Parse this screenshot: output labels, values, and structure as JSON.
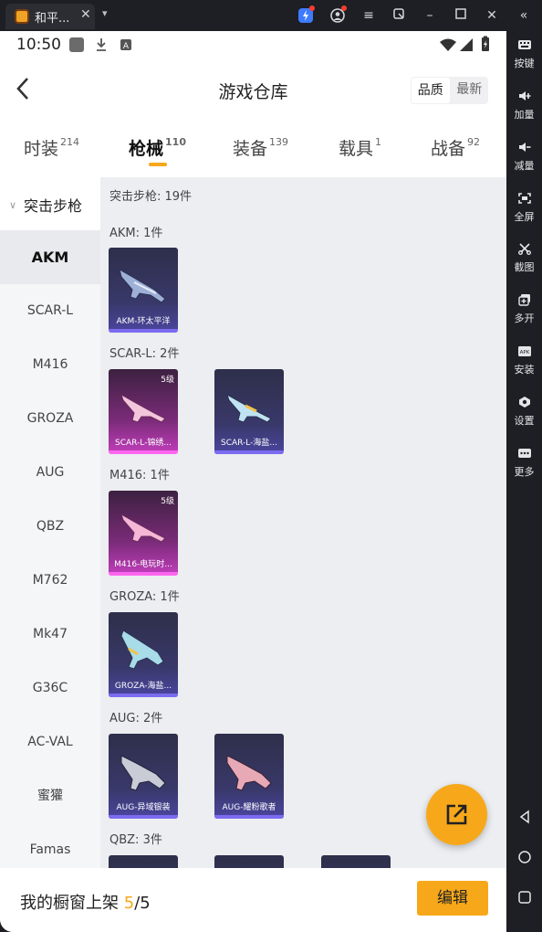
{
  "emulator": {
    "tab_title": "和平...",
    "tab_close": "✕",
    "sidebar": [
      {
        "label": "按键",
        "icon": "keyboard-icon"
      },
      {
        "label": "加量",
        "icon": "volume-up-icon"
      },
      {
        "label": "减量",
        "icon": "volume-down-icon"
      },
      {
        "label": "全屏",
        "icon": "fullscreen-icon"
      },
      {
        "label": "截图",
        "icon": "scissors-icon"
      },
      {
        "label": "多开",
        "icon": "multi-instance-icon"
      },
      {
        "label": "安装",
        "icon": "apk-install-icon"
      },
      {
        "label": "设置",
        "icon": "settings-icon"
      },
      {
        "label": "更多",
        "icon": "more-icon"
      }
    ]
  },
  "status_bar": {
    "time": "10:50"
  },
  "header": {
    "title": "游戏仓库",
    "sort": [
      "品质",
      "最新"
    ],
    "sort_active": "品质"
  },
  "tabs": [
    {
      "label": "时装",
      "count": "214"
    },
    {
      "label": "枪械",
      "count": "110",
      "active": true
    },
    {
      "label": "装备",
      "count": "139"
    },
    {
      "label": "载具",
      "count": "1"
    },
    {
      "label": "战备",
      "count": "92"
    }
  ],
  "weapon_list": {
    "group": "突击步枪",
    "items": [
      "AKM",
      "SCAR-L",
      "M416",
      "GROZA",
      "AUG",
      "QBZ",
      "M762",
      "Mk47",
      "G36C",
      "AC-VAL",
      "蜜獾",
      "Famas"
    ],
    "active": "AKM"
  },
  "content": {
    "category_summary": "突击步枪: 19件",
    "sections": [
      {
        "title": "AKM: 1件",
        "cards": [
          {
            "name": "AKM-环太平洋",
            "rarity": "blue",
            "level": ""
          }
        ]
      },
      {
        "title": "SCAR-L: 2件",
        "cards": [
          {
            "name": "SCAR-L-锦绣...",
            "rarity": "pink",
            "level": "5级"
          },
          {
            "name": "SCAR-L-海盐...",
            "rarity": "blue",
            "level": ""
          }
        ]
      },
      {
        "title": "M416: 1件",
        "cards": [
          {
            "name": "M416-电玩时...",
            "rarity": "pink",
            "level": "5级"
          }
        ]
      },
      {
        "title": "GROZA: 1件",
        "cards": [
          {
            "name": "GROZA-海盐...",
            "rarity": "blue",
            "level": ""
          }
        ]
      },
      {
        "title": "AUG: 2件",
        "cards": [
          {
            "name": "AUG-异域银装",
            "rarity": "blue",
            "level": ""
          },
          {
            "name": "AUG-耀粉歌者",
            "rarity": "blue",
            "level": ""
          }
        ]
      },
      {
        "title": "QBZ: 3件",
        "cards": []
      }
    ]
  },
  "footer": {
    "label": "我的橱窗上架",
    "count_current": "5",
    "count_total": "/5",
    "edit_button": "编辑"
  },
  "colors": {
    "accent": "#f7a81a",
    "blue_card": "#3b3a6b",
    "pink_card": "#b23bb0"
  }
}
